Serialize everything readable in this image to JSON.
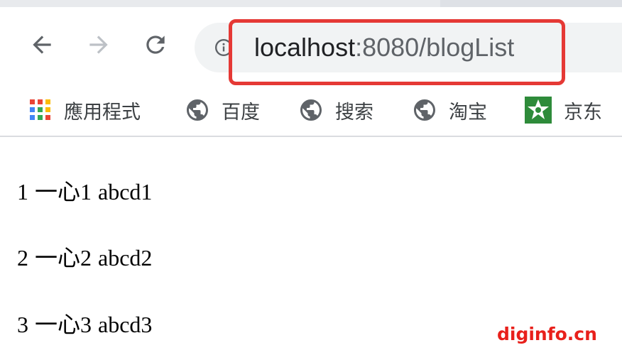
{
  "browser": {
    "address_bar": {
      "host": "localhost",
      "rest": ":8080/blogList"
    },
    "bookmarks": [
      {
        "label": "應用程式",
        "icon": "apps-grid-icon"
      },
      {
        "label": "百度",
        "icon": "globe-icon"
      },
      {
        "label": "搜索",
        "icon": "globe-icon"
      },
      {
        "label": "淘宝",
        "icon": "globe-icon"
      },
      {
        "label": "京东",
        "icon": "jd-logo-icon"
      }
    ],
    "highlight_color": "#e53935"
  },
  "page": {
    "rows": [
      {
        "id": "1",
        "name": "一心1",
        "content": "abcd1"
      },
      {
        "id": "2",
        "name": "一心2",
        "content": "abcd2"
      },
      {
        "id": "3",
        "name": "一心3",
        "content": "abcd3"
      }
    ]
  },
  "watermark": "diginfo.cn"
}
